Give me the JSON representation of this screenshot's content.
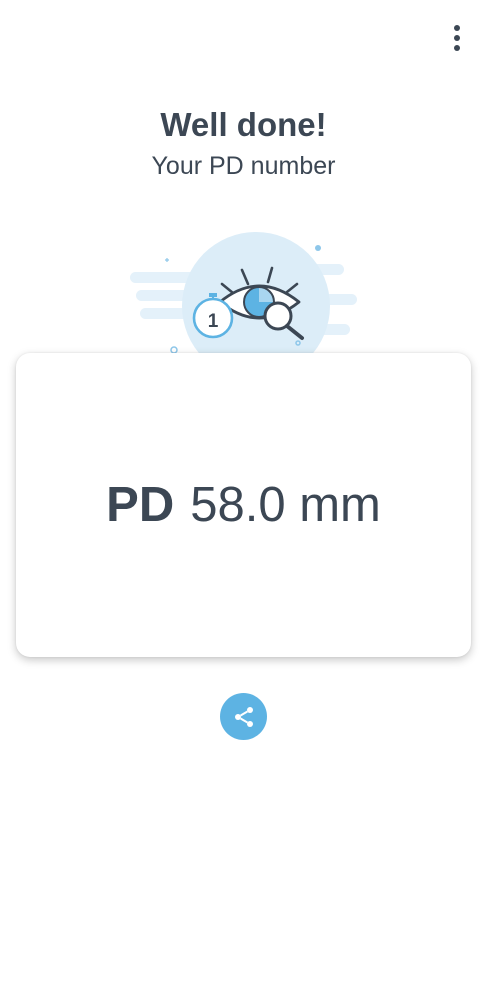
{
  "header": {
    "menu_icon": "more-vert-icon"
  },
  "heading": {
    "title": "Well done!",
    "subtitle": "Your PD number"
  },
  "illustration": {
    "icon": "eye-measure-illustration",
    "stopwatch_digit": "1"
  },
  "result": {
    "label": "PD",
    "value": "58.0 mm"
  },
  "actions": {
    "share_icon": "share-icon"
  },
  "colors": {
    "text": "#3c4754",
    "accent": "#5db3e3",
    "illustration_bg": "#dcedf8"
  }
}
